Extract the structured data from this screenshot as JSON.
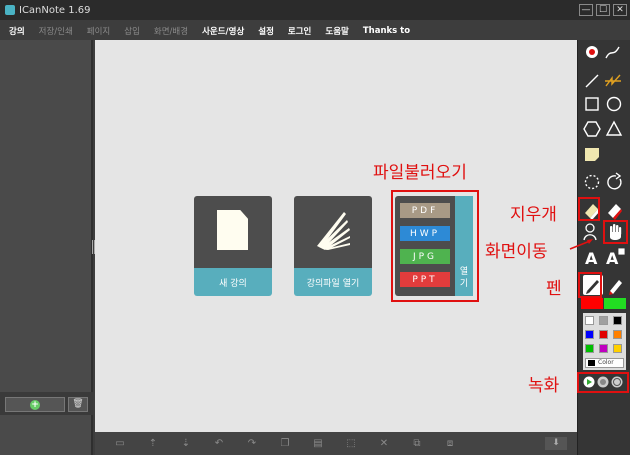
{
  "window": {
    "title": "ICanNote 1.69",
    "minimize_glyph": "—",
    "maximize_glyph": "☐",
    "close_glyph": "✕"
  },
  "menu": [
    {
      "label": "강의",
      "state": "active"
    },
    {
      "label": "저장/인쇄",
      "state": "disabled"
    },
    {
      "label": "페이지",
      "state": "disabled"
    },
    {
      "label": "삽입",
      "state": "disabled"
    },
    {
      "label": "화면/배경",
      "state": "disabled"
    },
    {
      "label": "사운드/영상",
      "state": "enabled"
    },
    {
      "label": "설정",
      "state": "enabled"
    },
    {
      "label": "로그인",
      "state": "enabled"
    },
    {
      "label": "도움말",
      "state": "enabled"
    },
    {
      "label": "Thanks to",
      "state": "enabled"
    }
  ],
  "cards": {
    "new_lecture": "새 강의",
    "open_lecture_file": "강의파일 열기",
    "open_label_1": "열",
    "open_label_2": "기",
    "formats": [
      "PDF",
      "HWP",
      "JPG",
      "PPT"
    ]
  },
  "annotations": {
    "import_file": "파일불러오기",
    "eraser": "지우개",
    "pan_screen": "화면이동",
    "pen": "펜",
    "record": "녹화"
  },
  "palette": {
    "color_button_label": "Color",
    "swatches": [
      "#ffffff",
      "#a0a0a0",
      "#000000",
      "#0000ff",
      "#e00000",
      "#ff8000",
      "#00c000",
      "#c000c0",
      "#ffd000"
    ],
    "pen_color": "#ff0000",
    "highlighter_color": "#22dd22"
  },
  "left_panel": {
    "add_glyph": "+",
    "trash_glyph": "🗑"
  },
  "accent_color": "#58aebd",
  "annotation_color": "#e01010"
}
